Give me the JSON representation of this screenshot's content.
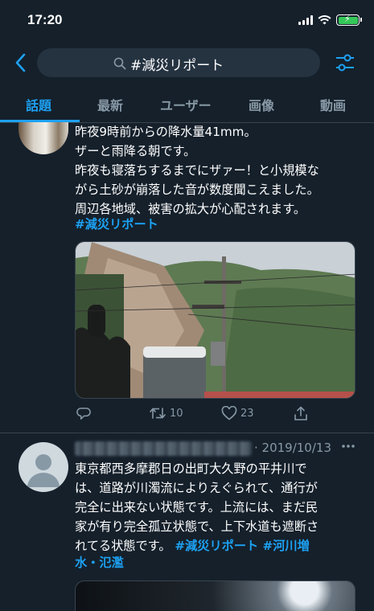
{
  "status_bar": {
    "time": "17:20"
  },
  "search": {
    "query": "#減災リポート"
  },
  "tabs": [
    {
      "label": "話題",
      "active": true
    },
    {
      "label": "最新",
      "active": false
    },
    {
      "label": "ユーザー",
      "active": false
    },
    {
      "label": "画像",
      "active": false
    },
    {
      "label": "動画",
      "active": false
    }
  ],
  "tweet1": {
    "lines": [
      "昨夜9時前からの降水量41mm。",
      "ザーと雨降る朝です。",
      "昨夜も寝落ちするまでにザァー！と小規模な",
      "がら土砂が崩落した音が数度聞こえました。",
      "周辺各地域、被害の拡大が心配されます。"
    ],
    "hashtag": "#減災リポート",
    "retweets": "10",
    "likes": "23"
  },
  "tweet2": {
    "date": "· 2019/10/13",
    "lines": [
      "東京都西多摩郡日の出町大久野の平井川で",
      "は、道路が川濁流によりえぐられて、通行が",
      "完全に出来ない状態です。上流には、まだ民",
      "家が有り完全孤立状態で、上下水道も遮断さ"
    ],
    "line5_text": "れてる状態です。 ",
    "line5_tag1": "#減災リポート",
    "line5_tag2": " #河川増",
    "line6_tag": "水・氾濫"
  },
  "colors": {
    "background": "#15202b",
    "accent": "#1da1f2",
    "muted": "#8899a6",
    "divider": "#38444d"
  }
}
